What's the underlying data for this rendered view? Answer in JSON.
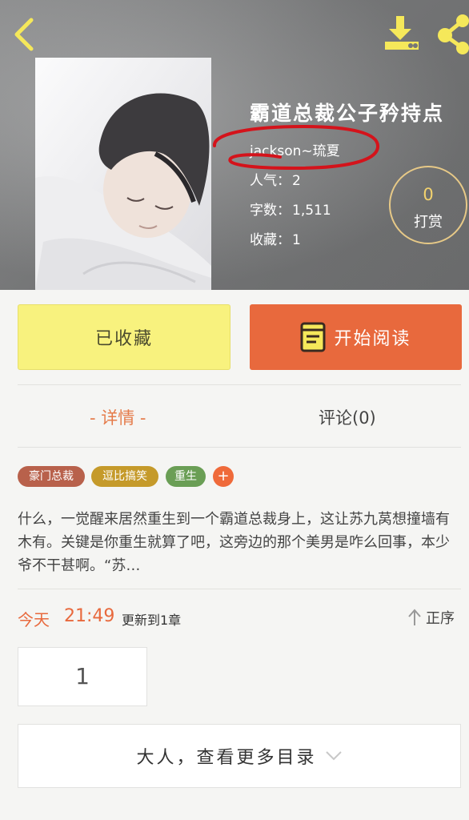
{
  "header": {
    "title": "霸道总裁公子矜持点",
    "author": "jackson~琉夏",
    "stats": [
      {
        "label": "人气：",
        "value": "2"
      },
      {
        "label": "字数：",
        "value": "1,511"
      },
      {
        "label": "收藏：",
        "value": "1"
      }
    ],
    "reward": {
      "count": "0",
      "label": "打赏"
    }
  },
  "actions": {
    "favorite_label": "已收藏",
    "read_label": "开始阅读"
  },
  "tabs": {
    "detail": "- 详情 -",
    "comment": "评论(0)"
  },
  "tags": [
    {
      "label": "豪门总裁",
      "color": "#b8614b"
    },
    {
      "label": "逗比搞笑",
      "color": "#c59a2a"
    },
    {
      "label": "重生",
      "color": "#6a9e55"
    }
  ],
  "tag_add": "+",
  "synopsis": "什么，一觉醒来居然重生到一个霸道总裁身上，这让苏九莴想撞墙有木有。关键是你重生就算了吧，这旁边的那个美男是咋么回事，本少爷不干甚啊。“苏…",
  "update": {
    "today": "今天",
    "time": "21:49",
    "text": "更新到1章",
    "sort_label": "正序"
  },
  "chapters": [
    "1"
  ],
  "more_catalog": "大人，查看更多目录",
  "colors": {
    "accent": "#e8693d",
    "favorite_bg": "#f8f27e",
    "annotation": "#d4131b",
    "icon_yellow": "#f5e85a"
  }
}
